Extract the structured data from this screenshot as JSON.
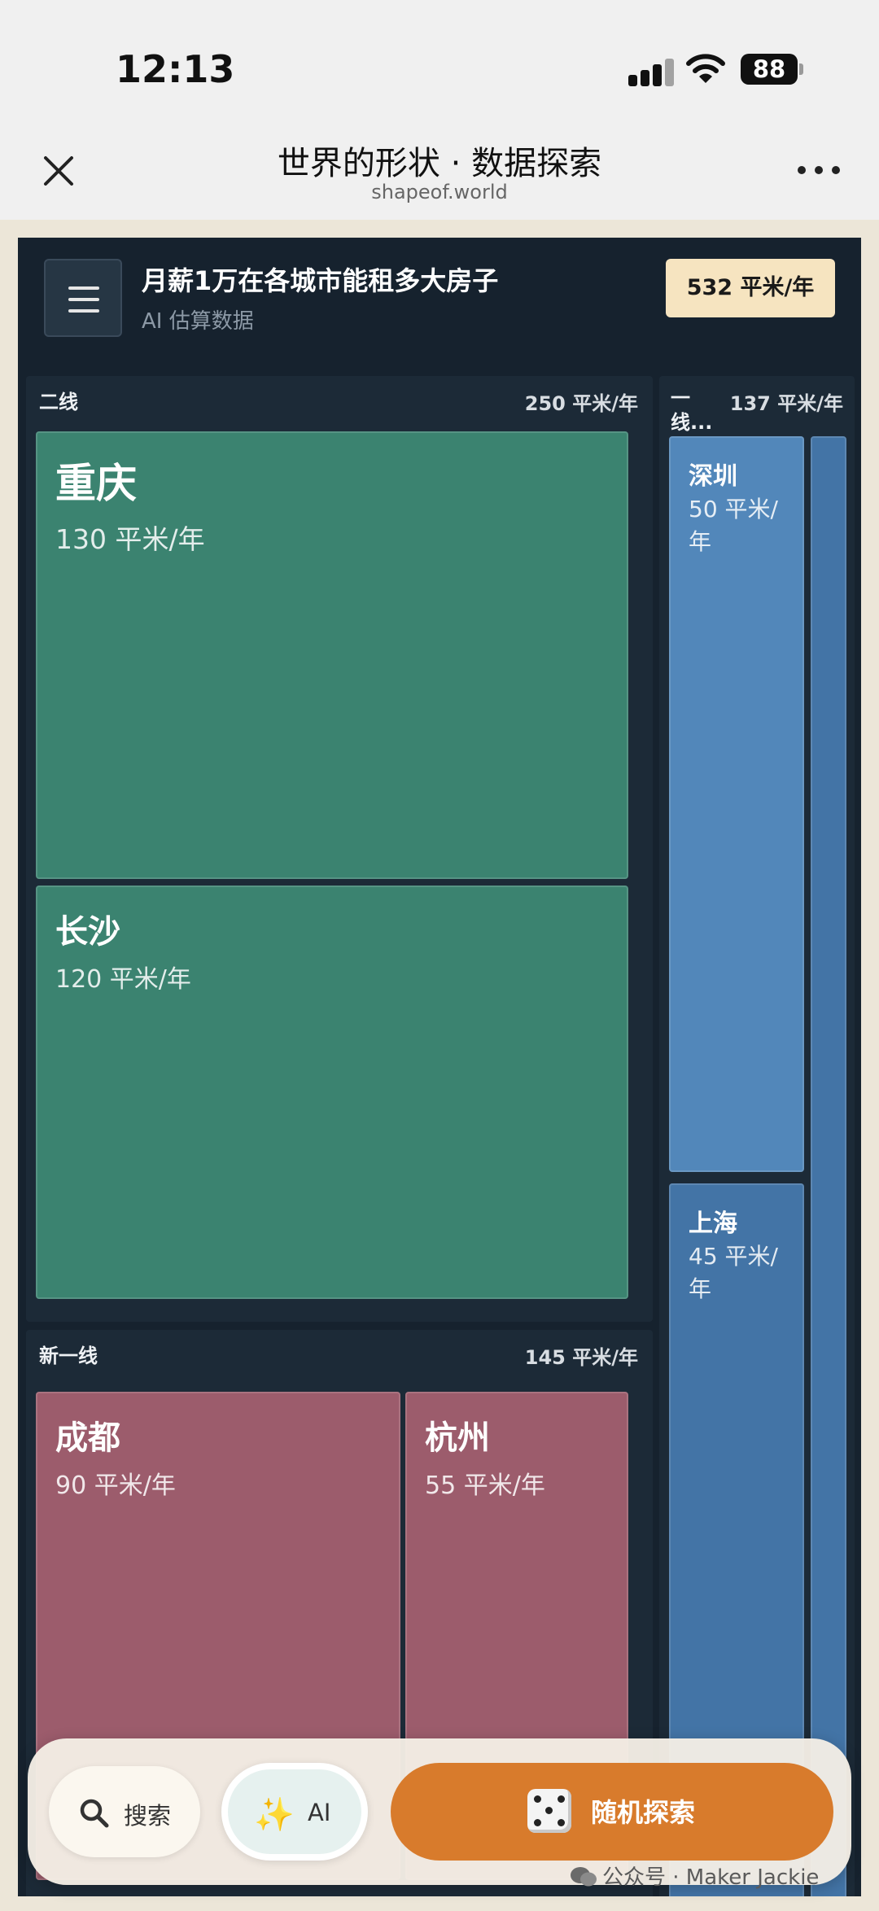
{
  "status_bar": {
    "time": "12:13",
    "battery": "88"
  },
  "nav": {
    "title": "世界的形状 · 数据探索",
    "subtitle": "shapeof.world"
  },
  "app": {
    "title": "月薪1万在各城市能租多大房子",
    "subtitle": "AI 估算数据",
    "total": "532 平米/年"
  },
  "groups": [
    {
      "label": "二线",
      "total": "250 平米/年",
      "color": "#3b8370",
      "cities": [
        {
          "name": "重庆",
          "value": "130 平米/年"
        },
        {
          "name": "长沙",
          "value": "120 平米/年"
        }
      ]
    },
    {
      "label": "新一线",
      "total": "145 平米/年",
      "color": "#9c5c6c",
      "cities": [
        {
          "name": "成都",
          "value": "90 平米/年"
        },
        {
          "name": "杭州",
          "value": "55 平米/年"
        }
      ]
    },
    {
      "label": "一线...",
      "total": "137 平米/年",
      "color": "#5287ba",
      "cities": [
        {
          "name": "深圳",
          "value": "50 平米/年"
        },
        {
          "name": "上海",
          "value": "45 平米/年"
        },
        {
          "name": "",
          "value": ""
        }
      ]
    }
  ],
  "bottom_bar": {
    "search_label": "搜索",
    "ai_label": "AI",
    "random_label": "随机探索"
  },
  "watermark": "公众号 · Maker Jackie",
  "chart_data": {
    "type": "treemap",
    "title": "月薪1万在各城市能租多大房子",
    "subtitle": "AI 估算数据",
    "unit": "平米/年",
    "total": 532,
    "groups": [
      {
        "name": "二线",
        "total": 250,
        "items": [
          {
            "name": "重庆",
            "value": 130
          },
          {
            "name": "长沙",
            "value": 120
          }
        ]
      },
      {
        "name": "新一线",
        "total": 145,
        "items": [
          {
            "name": "成都",
            "value": 90
          },
          {
            "name": "杭州",
            "value": 55
          }
        ]
      },
      {
        "name": "一线...",
        "total": 137,
        "items": [
          {
            "name": "深圳",
            "value": 50
          },
          {
            "name": "上海",
            "value": 45
          }
        ]
      }
    ]
  }
}
